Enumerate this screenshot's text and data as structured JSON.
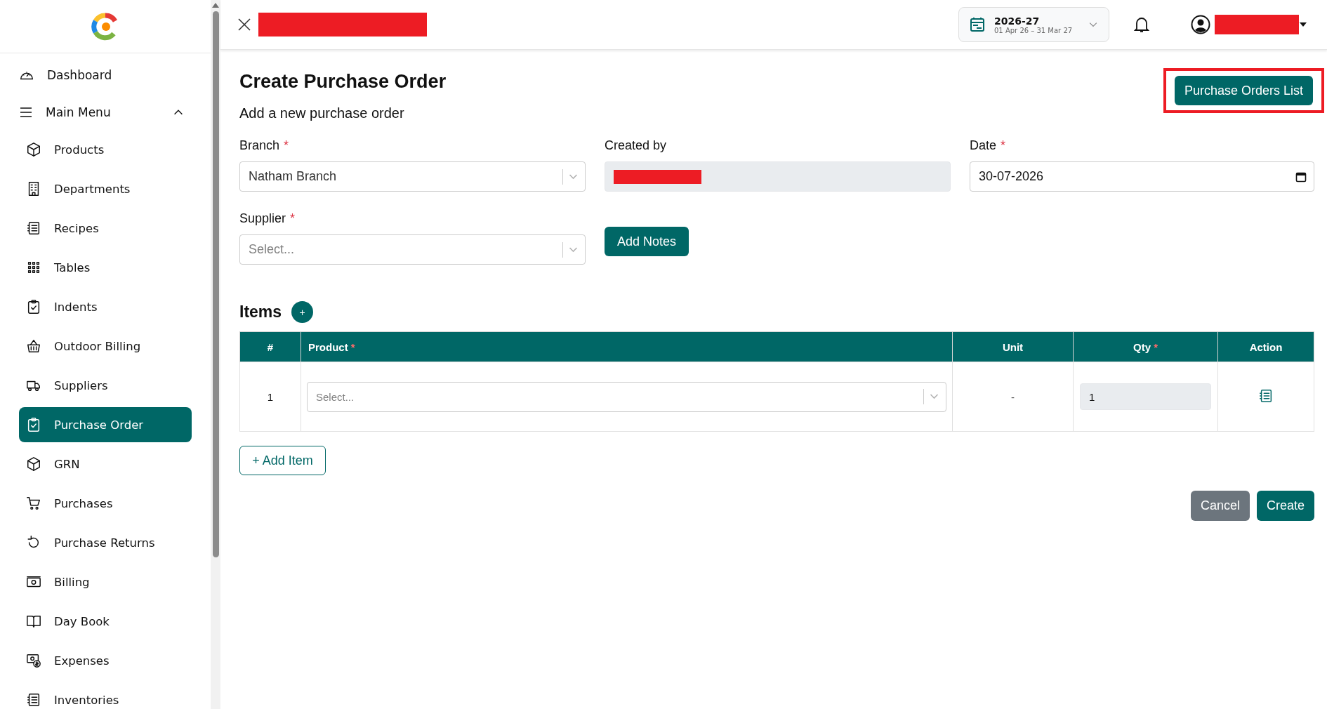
{
  "header": {
    "fiscal_year": {
      "title": "2026-27",
      "range": "01 Apr 26 – 31 Mar 27"
    }
  },
  "sidebar": {
    "items": [
      {
        "label": "Dashboard",
        "selected": false
      },
      {
        "label": "Main Menu",
        "expanded": true,
        "selected": false,
        "children": [
          {
            "label": "Products",
            "selected": false
          },
          {
            "label": "Departments",
            "selected": false
          },
          {
            "label": "Recipes",
            "selected": false
          },
          {
            "label": "Tables",
            "selected": false
          },
          {
            "label": "Indents",
            "selected": false
          },
          {
            "label": "Outdoor Billing",
            "selected": false
          },
          {
            "label": "Suppliers",
            "selected": false
          },
          {
            "label": "Purchase Order",
            "selected": true
          },
          {
            "label": "GRN",
            "selected": false
          },
          {
            "label": "Purchases",
            "selected": false
          },
          {
            "label": "Purchase Returns",
            "selected": false
          },
          {
            "label": "Billing",
            "selected": false
          },
          {
            "label": "Day Book",
            "selected": false
          },
          {
            "label": "Expenses",
            "selected": false
          },
          {
            "label": "Inventories",
            "selected": false
          }
        ]
      }
    ]
  },
  "page": {
    "title": "Create Purchase Order",
    "subtitle": "Add a new purchase order",
    "list_button": {
      "label": "Purchase Orders List",
      "highlighted": true
    },
    "fields": [
      {
        "kind": "select",
        "label": "Branch",
        "required_mark": "*",
        "value": "Natham Branch"
      },
      {
        "kind": "readonly",
        "label": "Created by"
      },
      {
        "kind": "date",
        "label": "Date",
        "required_mark": "*",
        "value": "30-07-2026"
      },
      {
        "kind": "select",
        "label": "Supplier",
        "required_mark": "*",
        "placeholder": "Select..."
      }
    ],
    "notes_button": "Add Notes",
    "items_title": "Items",
    "add_icon": "+",
    "table": {
      "columns": [
        {
          "label": "#"
        },
        {
          "label": "Product",
          "required_mark": "*"
        },
        {
          "label": "Unit"
        },
        {
          "label": "Qty",
          "required_mark": "*"
        },
        {
          "label": "Action"
        }
      ],
      "rows": [
        {
          "number": "1",
          "product_placeholder": "Select...",
          "unit": "-",
          "qty": "1"
        }
      ]
    },
    "add_item_button": "+ Add Item",
    "buttons": [
      {
        "kind": "secondary",
        "label": "Cancel"
      },
      {
        "kind": "primary",
        "label": "Create"
      }
    ]
  }
}
